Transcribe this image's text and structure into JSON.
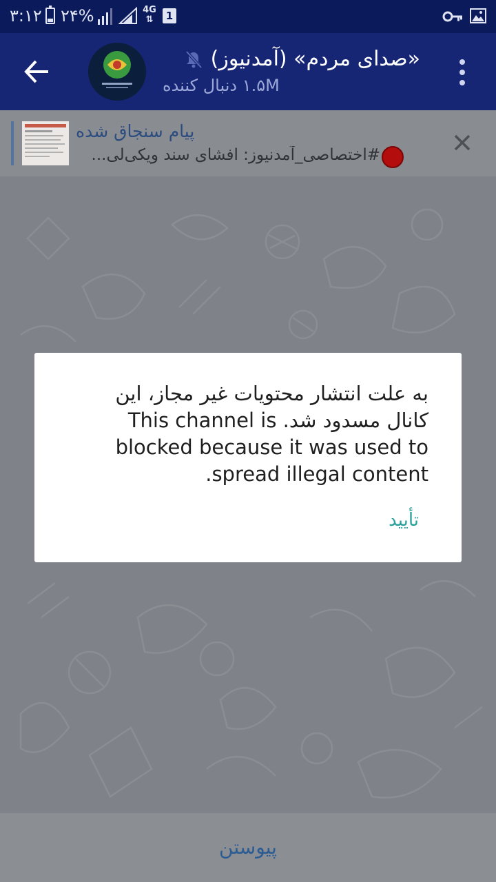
{
  "status_bar": {
    "time": "۳:۱۲",
    "battery": "۲۴%",
    "network_type": "4G",
    "sim_slot": "1"
  },
  "header": {
    "channel_title": "«صدای مردم» (آمدنیوز)",
    "subscribers": "۱.۵M دنبال کننده"
  },
  "pinned": {
    "title": "پیام سنجاق شده",
    "text": "#اختصاصی_آمدنیوز: افشای سند ویکی‌لی..."
  },
  "dialog": {
    "message": "به علت انتشار محتویات غیر مجاز، این کانال مسدود شد. This channel is blocked because it was used to spread illegal content.",
    "confirm_label": "تأیید"
  },
  "bottom": {
    "join_label": "پیوستن"
  },
  "colors": {
    "status_bar": "#0b1a5a",
    "app_bar": "#172575",
    "accent_confirm": "#2aa19a",
    "join_text": "#2a5c93",
    "pinned_dot": "#b30d0d"
  }
}
